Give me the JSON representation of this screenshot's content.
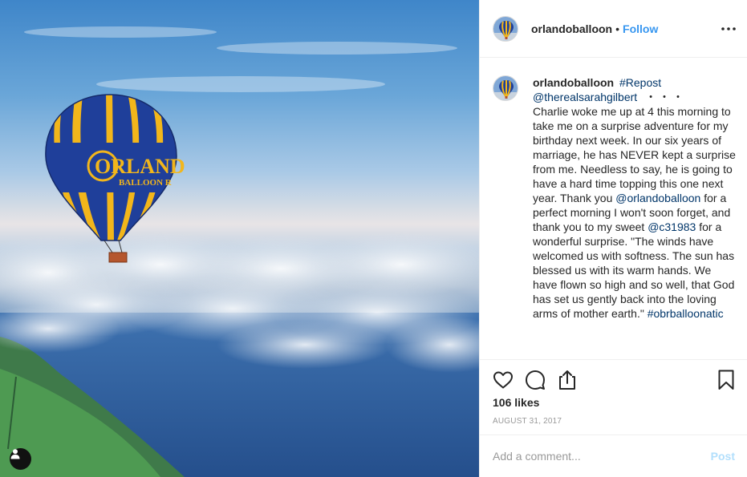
{
  "post": {
    "photo": {
      "balloon_text_line1": "ORLAND",
      "balloon_text_line2": "BALLOON R",
      "user_tag_icon": "person-icon"
    },
    "header": {
      "username": "orlandoballoon",
      "separator": "•",
      "follow_label": "Follow",
      "more_icon": "more-options-icon"
    },
    "caption": {
      "username": "orlandoballoon",
      "hashtag_repost": "#Repost",
      "mention": "@therealsarahgilbert",
      "more_marker": "・・・",
      "body_part1": "Charlie woke me up at 4 this morning to take me on a surprise adventure for my birthday next week. In our six years of marriage, he has NEVER kept a surprise from me. Needless to say, he is going to have a hard time topping this one next year. Thank you ",
      "mention2": "@orlandoballoon",
      "body_part2": " for a perfect morning I won't soon forget, and thank you to my sweet ",
      "mention3": "@c31983",
      "body_part3": " for a wonderful surprise. \"The winds have welcomed us with softness. The sun has blessed us with its warm hands. We have flown so high and so well, that God has set us gently back into the loving arms of mother earth.\" ",
      "hashtag_end": "#obrballoonatic"
    },
    "actions": {
      "like_icon": "heart-icon",
      "comment_icon": "comment-icon",
      "share_icon": "share-icon",
      "save_icon": "bookmark-icon"
    },
    "likes": "106 likes",
    "date": "AUGUST 31, 2017",
    "comment": {
      "placeholder": "Add a comment...",
      "value": "",
      "post_label": "Post"
    },
    "colors": {
      "link": "#003569",
      "follow": "#3897f0",
      "post_disabled": "#b2dffc",
      "balloon_blue": "#1f3f9a",
      "balloon_yellow": "#f2b61b"
    }
  }
}
